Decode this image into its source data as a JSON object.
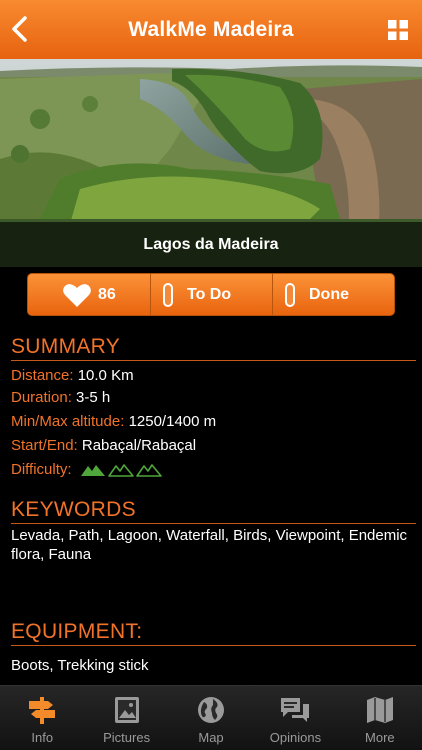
{
  "header": {
    "title": "WalkMe Madeira"
  },
  "hero": {
    "caption": "Lagos da Madeira"
  },
  "actions": {
    "likes": "86",
    "todo_label": "To Do",
    "done_label": "Done"
  },
  "summary": {
    "title": "SUMMARY",
    "distance_label": "Distance:",
    "distance_value": "10.0 Km",
    "duration_label": "Duration:",
    "duration_value": "3-5 h",
    "altitude_label": "Min/Max altitude:",
    "altitude_value": "1250/1400 m",
    "startend_label": "Start/End:",
    "startend_value": "Rabaçal/Rabaçal",
    "difficulty_label": "Difficulty:",
    "difficulty_level": 1,
    "difficulty_max": 3
  },
  "keywords": {
    "title": "KEYWORDS",
    "text": "Levada, Path, Lagoon, Waterfall, Birds, Viewpoint, Endemic flora, Fauna"
  },
  "equipment": {
    "title": "EQUIPMENT:",
    "text": "Boots,  Trekking stick"
  },
  "tabs": [
    {
      "label": "Info",
      "icon": "signpost-icon",
      "active": true
    },
    {
      "label": "Pictures",
      "icon": "picture-icon",
      "active": false
    },
    {
      "label": "Map",
      "icon": "globe-icon",
      "active": false
    },
    {
      "label": "Opinions",
      "icon": "chat-bubbles-icon",
      "active": false
    },
    {
      "label": "More",
      "icon": "folded-map-icon",
      "active": false
    }
  ],
  "colors": {
    "accent": "#f1732a",
    "header": "#ef7420",
    "difficulty_on": "#4fa63a",
    "tab_active": "#f38b2b"
  }
}
